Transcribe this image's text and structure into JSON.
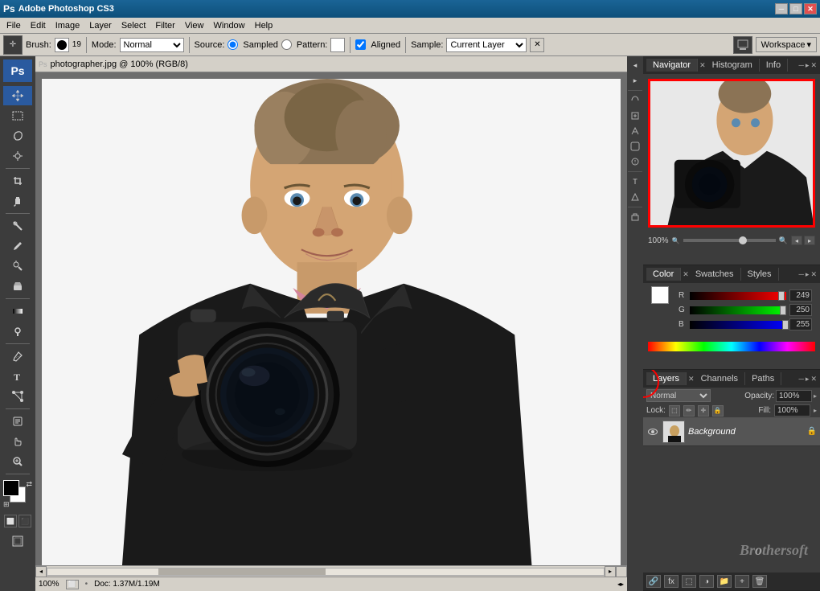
{
  "titlebar": {
    "title": "Adobe Photoshop CS3",
    "min_btn": "─",
    "max_btn": "□",
    "close_btn": "✕"
  },
  "menubar": {
    "items": [
      "File",
      "Edit",
      "Image",
      "Layer",
      "Select",
      "Filter",
      "View",
      "Window",
      "Help"
    ]
  },
  "options_bar": {
    "brush_label": "Brush:",
    "brush_size": "19",
    "mode_label": "Mode:",
    "mode_value": "Normal",
    "source_label": "Source:",
    "sampled_label": "Sampled",
    "pattern_label": "Pattern:",
    "aligned_label": "Aligned",
    "sample_label": "Sample:",
    "sample_value": "Current Layer",
    "workspace_label": "Workspace"
  },
  "canvas": {
    "title": "photographer.jpg @ 100% (RGB/8)",
    "zoom_label": "100%",
    "doc_info": "Doc: 1.37M/1.19M"
  },
  "navigator": {
    "panel_title": "Navigator",
    "tab1": "Navigator",
    "tab2": "Histogram",
    "tab3": "Info",
    "zoom_percent": "100%"
  },
  "color_panel": {
    "tab1": "Color",
    "tab2": "Swatches",
    "tab3": "Styles",
    "r_label": "R",
    "g_label": "G",
    "b_label": "B",
    "r_value": "249",
    "g_value": "250",
    "b_value": "255"
  },
  "layers_panel": {
    "tab1": "Layers",
    "tab2": "Channels",
    "tab3": "Paths",
    "blend_mode": "Normal",
    "opacity_label": "Opacity:",
    "opacity_value": "100%",
    "lock_label": "Lock:",
    "fill_label": "Fill:",
    "fill_value": "100%",
    "layer_name": "Background"
  },
  "left_toolbar": {
    "tools": [
      {
        "name": "move",
        "icon": "✛"
      },
      {
        "name": "marquee",
        "icon": "⬚"
      },
      {
        "name": "lasso",
        "icon": "⌒"
      },
      {
        "name": "magic-wand",
        "icon": "✦"
      },
      {
        "name": "crop",
        "icon": "⊡"
      },
      {
        "name": "slice",
        "icon": "⋯"
      },
      {
        "name": "healing",
        "icon": "✚"
      },
      {
        "name": "brush",
        "icon": "✏"
      },
      {
        "name": "clone-stamp",
        "icon": "⊕"
      },
      {
        "name": "history-brush",
        "icon": "↺"
      },
      {
        "name": "eraser",
        "icon": "⬜"
      },
      {
        "name": "gradient",
        "icon": "▭"
      },
      {
        "name": "dodge",
        "icon": "○"
      },
      {
        "name": "pen",
        "icon": "✒"
      },
      {
        "name": "type",
        "icon": "T"
      },
      {
        "name": "path-select",
        "icon": "↗"
      },
      {
        "name": "shape",
        "icon": "◻"
      },
      {
        "name": "notes",
        "icon": "🗒"
      },
      {
        "name": "eyedropper",
        "icon": "⦿"
      },
      {
        "name": "hand",
        "icon": "✋"
      },
      {
        "name": "zoom",
        "icon": "🔍"
      }
    ]
  },
  "status_bar": {
    "zoom": "100%",
    "doc_info": "Doc: 1.37M/1.19M"
  }
}
